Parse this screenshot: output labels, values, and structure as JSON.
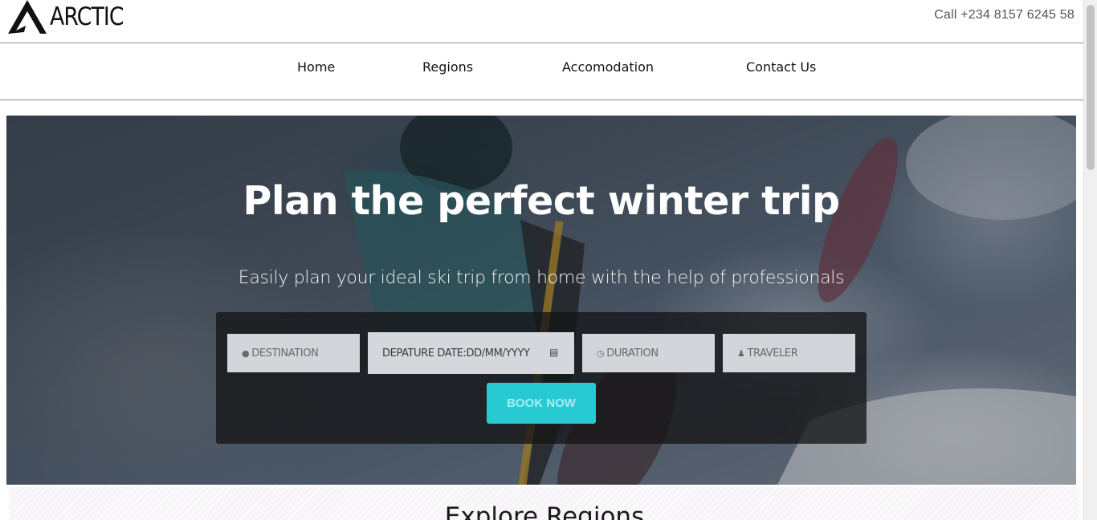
{
  "header": {
    "brand": "ARCTIC",
    "logo_icon": "arctic-a-logo-icon",
    "call_text": "Call +234 8157 6245 58"
  },
  "nav": {
    "items": [
      {
        "label": "Home"
      },
      {
        "label": "Regions"
      },
      {
        "label": "Accomodation"
      },
      {
        "label": "Contact Us"
      }
    ]
  },
  "hero": {
    "title": "Plan the perfect winter trip",
    "subtitle": "Easily plan your ideal ski trip from home with the help of professionals",
    "form": {
      "destination_placeholder": "DESTINATION",
      "destination_icon": "map-marker-icon",
      "date_value": "DEPATURE DATE:DD/MM/YYYY",
      "date_icon": "calendar-icon",
      "duration_placeholder": "DURATION",
      "duration_icon": "clock-icon",
      "traveler_placeholder": "TRAVELER",
      "traveler_icon": "user-icon",
      "book_label": "BOOK NOW"
    }
  },
  "explore": {
    "title": "Explore Regions"
  },
  "colors": {
    "accent": "#27c9d3",
    "panel": "#141416",
    "text": "#111111"
  }
}
